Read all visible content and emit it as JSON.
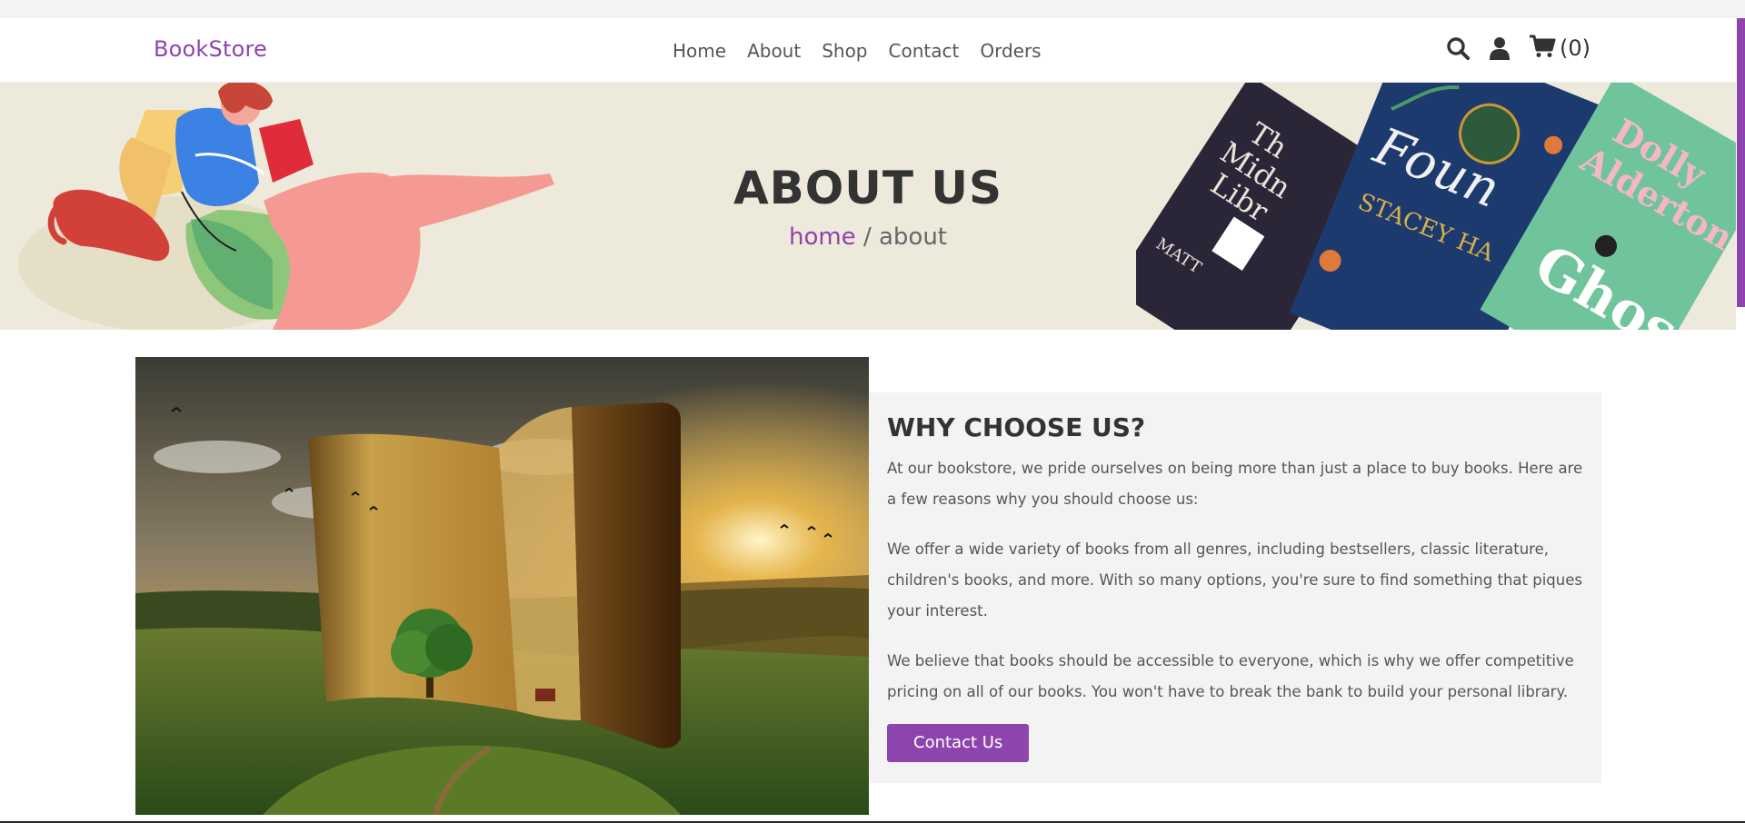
{
  "header": {
    "logo": "BookStore",
    "nav": [
      "Home",
      "About",
      "Shop",
      "Contact",
      "Orders"
    ],
    "cart_count": "(0)",
    "icons": [
      "search-icon",
      "user-icon",
      "cart-icon"
    ]
  },
  "hero": {
    "title": "ABOUT US",
    "breadcrumb_home": "home",
    "breadcrumb_sep": " / ",
    "breadcrumb_current": "about",
    "book_titles": [
      "The Midnight Library",
      "The Foundling",
      "Ghosts"
    ],
    "book_authors": [
      "MATT",
      "STACEY HALLS",
      "Dolly Alderton"
    ]
  },
  "about": {
    "heading": "WHY CHOOSE US?",
    "paragraphs": [
      "At our bookstore, we pride ourselves on being more than just a place to buy books. Here are a few reasons why you should choose us:",
      "We offer a wide variety of books from all genres, including bestsellers, classic literature, children's books, and more. With so many options, you're sure to find something that piques your interest.",
      "We believe that books should be accessible to everyone, which is why we offer competitive pricing on all of our books. You won't have to break the bank to build your personal library."
    ],
    "button": "Contact Us"
  },
  "colors": {
    "accent": "#8e44ad",
    "hero_bg": "#eeeadb",
    "panel_bg": "#f3f3f3",
    "text_dark": "#333333"
  }
}
